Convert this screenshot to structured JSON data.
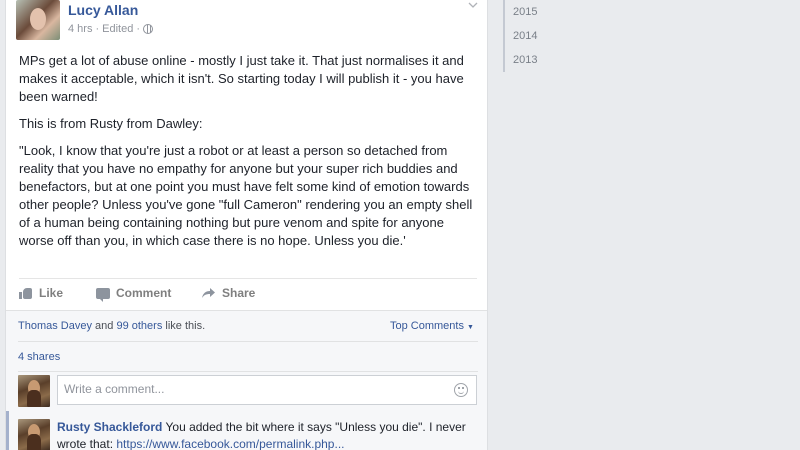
{
  "post": {
    "author": "Lucy Allan",
    "time": "4 hrs",
    "edited": "Edited",
    "paragraphs": [
      "MPs get a lot of abuse online - mostly I just take it. That just normalises it and makes it acceptable, which it isn't. So starting today I will publish it - you have been warned!",
      "This is from Rusty from Dawley:",
      "\"Look, I know that you're just a robot or at least a person so detached from reality that you have no empathy for anyone but your super rich buddies and benefactors, but at one point you must have felt some kind of emotion towards other people? Unless you've gone \"full Cameron\" rendering you an empty shell of a human being containing nothing but pure venom and spite for anyone worse off than you, in which case there is no hope. Unless you die.'"
    ],
    "actions": {
      "like": "Like",
      "comment": "Comment",
      "share": "Share"
    },
    "likes": {
      "name": "Thomas Davey",
      "connector": "and",
      "others": "99 others",
      "suffix": "like this."
    },
    "top_comments": "Top Comments",
    "shares": "4 shares",
    "comment_placeholder": "Write a comment...",
    "reply": {
      "name": "Rusty Shackleford",
      "text": "You added the bit where it says \"Unless you die\". I never wrote that:",
      "link": "https://www.facebook.com/permalink.php..."
    }
  },
  "sidebar": {
    "years": [
      "2015",
      "2014",
      "2013"
    ]
  },
  "colors": {
    "link": "#365899",
    "background": "#e9ebee"
  }
}
